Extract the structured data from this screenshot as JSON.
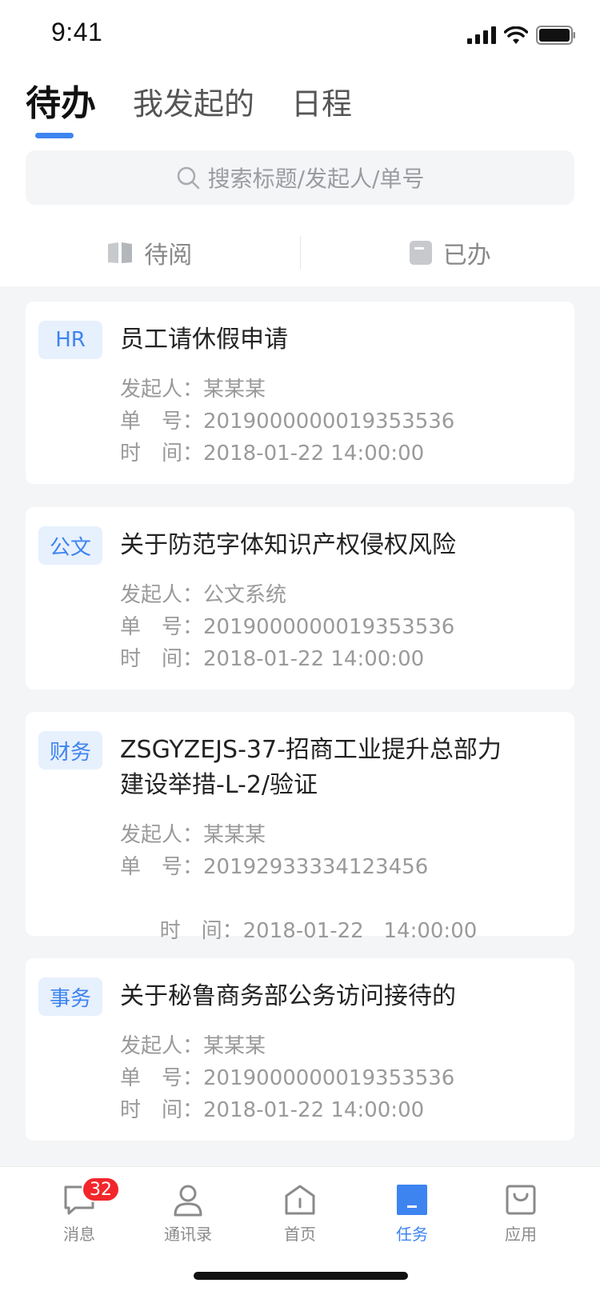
{
  "status_bar": {
    "time": "9:41"
  },
  "tabs": [
    {
      "label": "待办",
      "active": true
    },
    {
      "label": "我发起的",
      "active": false
    },
    {
      "label": "日程",
      "active": false
    }
  ],
  "search": {
    "placeholder": "搜索标题/发起人/单号"
  },
  "filters": [
    {
      "label": "待阅",
      "icon": "book-icon"
    },
    {
      "label": "已办",
      "icon": "document-icon"
    }
  ],
  "meta_labels": {
    "initiator": "发起人：",
    "number": "单　号：",
    "time": "时　间："
  },
  "tasks": [
    {
      "tag": "HR",
      "title": "员工请休假申请",
      "initiator": "某某某",
      "number": "2019000000019353536",
      "time": "2018-01-22  14:00:00"
    },
    {
      "tag": "公文",
      "title": "关于防范字体知识产权侵权风险",
      "initiator": "公文系统",
      "number": "2019000000019353536",
      "time": "2018-01-22  14:00:00"
    },
    {
      "tag": "财务",
      "title": "ZSGYZEJS-37-招商工业提升总部力建设举措-L-2/验证",
      "initiator": "某某某",
      "number": "20192933334123456",
      "time": "2018-01-22   14:00:00"
    },
    {
      "tag": "事务",
      "title": "关于秘鲁商务部公务访问接待的",
      "initiator": "某某某",
      "number": "2019000000019353536",
      "time": "2018-01-22  14:00:00"
    }
  ],
  "bottom_nav": [
    {
      "label": "消息",
      "icon": "message-icon",
      "badge": "32"
    },
    {
      "label": "通讯录",
      "icon": "contacts-icon"
    },
    {
      "label": "首页",
      "icon": "home-icon"
    },
    {
      "label": "任务",
      "icon": "task-icon",
      "active": true
    },
    {
      "label": "应用",
      "icon": "apps-bag-icon"
    }
  ],
  "colors": {
    "accent": "#3d84f0",
    "badge": "#f2262b",
    "tag_bg": "#e7f0fd"
  }
}
